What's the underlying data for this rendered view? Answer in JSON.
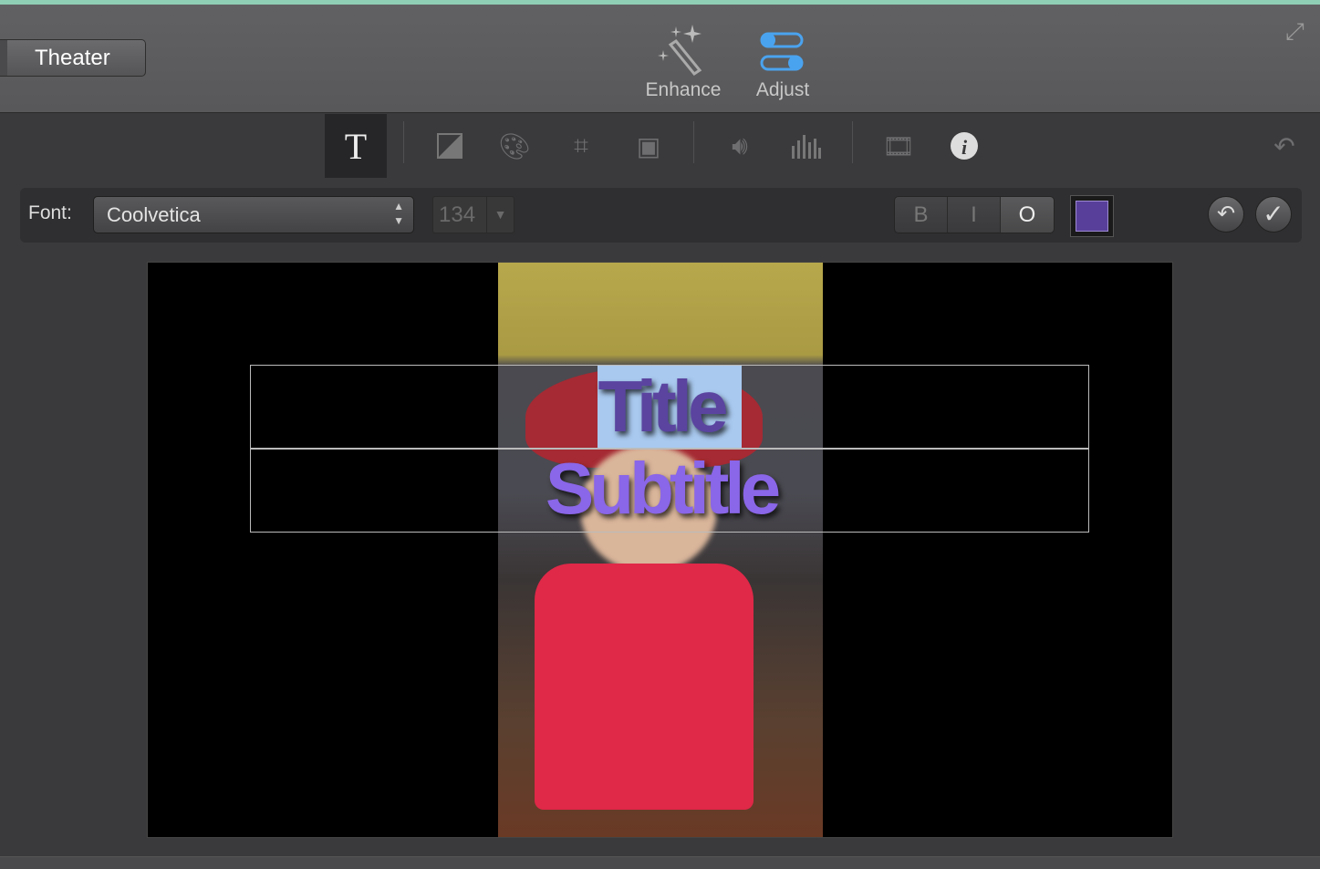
{
  "header": {
    "theater_label": "Theater",
    "enhance_label": "Enhance",
    "adjust_label": "Adjust"
  },
  "toolbar": {
    "tools": [
      "title-icon",
      "color-balance-icon",
      "color-correction-icon",
      "crop-icon",
      "stabilization-icon",
      "volume-icon",
      "noise-reduction-icon",
      "speed-icon",
      "clip-info-icon"
    ],
    "active_tool": "title-icon"
  },
  "fontbar": {
    "font_label": "Font:",
    "font_value": "Coolvetica",
    "size_value": "134",
    "bold_label": "B",
    "italic_label": "I",
    "outline_label": "O",
    "text_color": "#58409a"
  },
  "viewer": {
    "title_text": "Title",
    "subtitle_text": "Subtitle",
    "title_color": "#5a44a0",
    "subtitle_color": "#8a66e8"
  }
}
